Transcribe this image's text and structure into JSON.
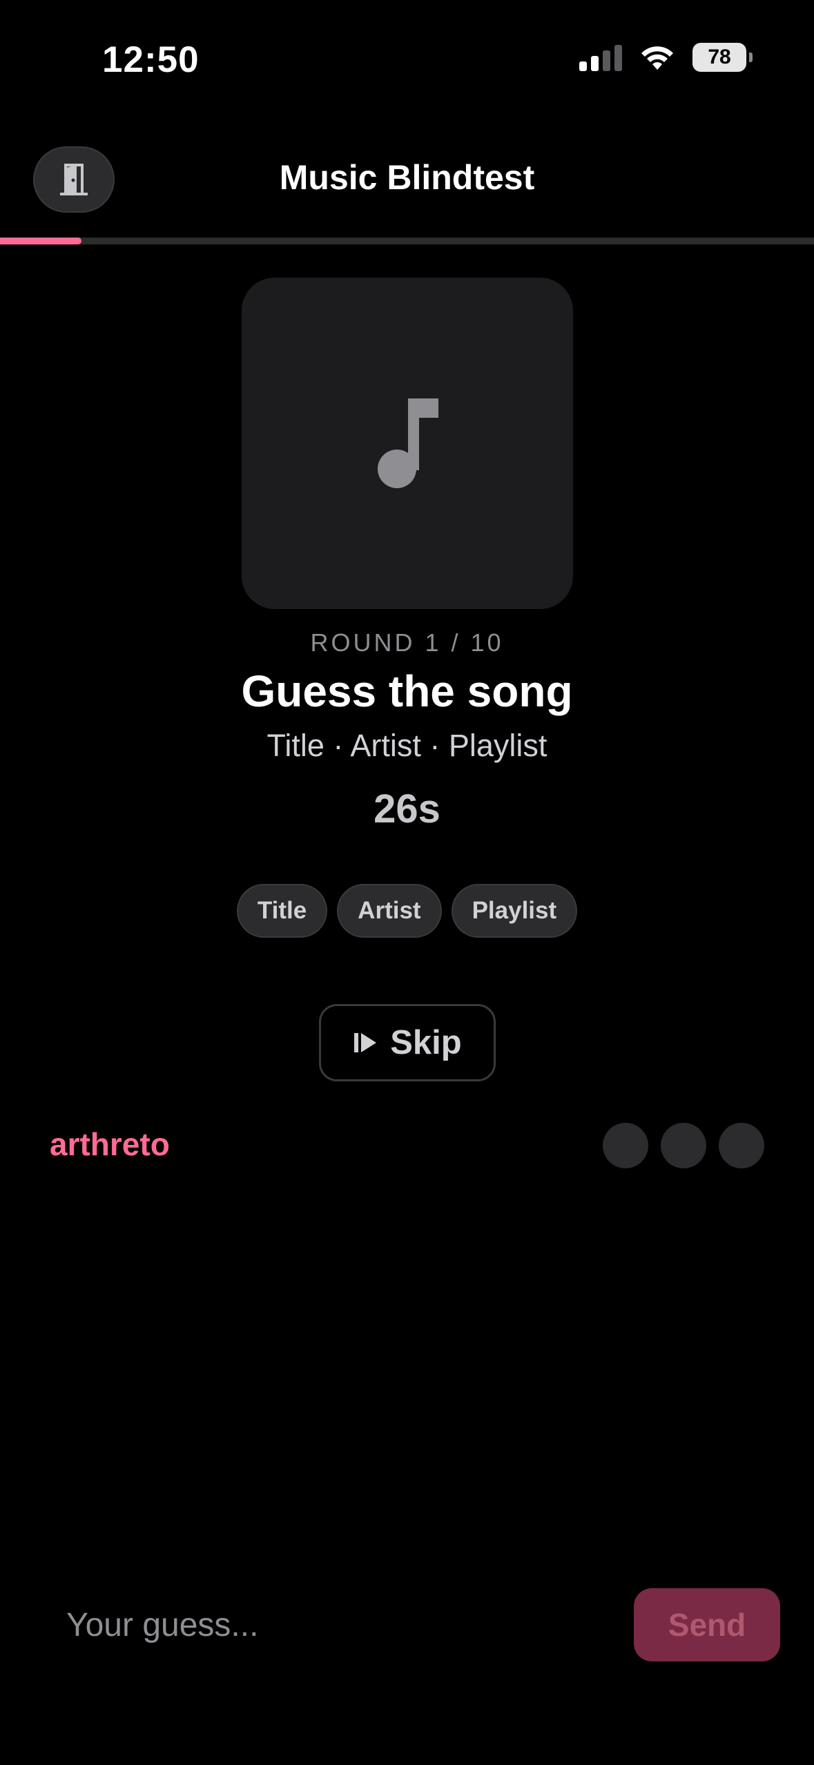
{
  "status_bar": {
    "time": "12:50",
    "battery": "78",
    "icons": [
      "signal-icon",
      "wifi-icon",
      "battery-icon"
    ]
  },
  "header": {
    "title": "Music Blindtest",
    "exit_icon": "door-exit-icon"
  },
  "progress": {
    "round_fraction": 0.1,
    "accent_color": "#ff6b95"
  },
  "game": {
    "artwork_icon": "music-note-icon",
    "round_label": "ROUND 1 / 10",
    "heading": "Guess the song",
    "subtitle": "Title · Artist · Playlist",
    "timer": "26s",
    "chips": [
      "Title",
      "Artist",
      "Playlist"
    ],
    "skip_label": "Skip",
    "skip_icon": "skip-forward-icon"
  },
  "player": {
    "name": "arthreto"
  },
  "guess": {
    "placeholder": "Your guess...",
    "send_label": "Send"
  },
  "colors": {
    "background": "#000000",
    "surface": "#1c1c1e",
    "chip": "#2c2c2e",
    "accent": "#ff6b95",
    "send_button": "#7a2a45"
  }
}
